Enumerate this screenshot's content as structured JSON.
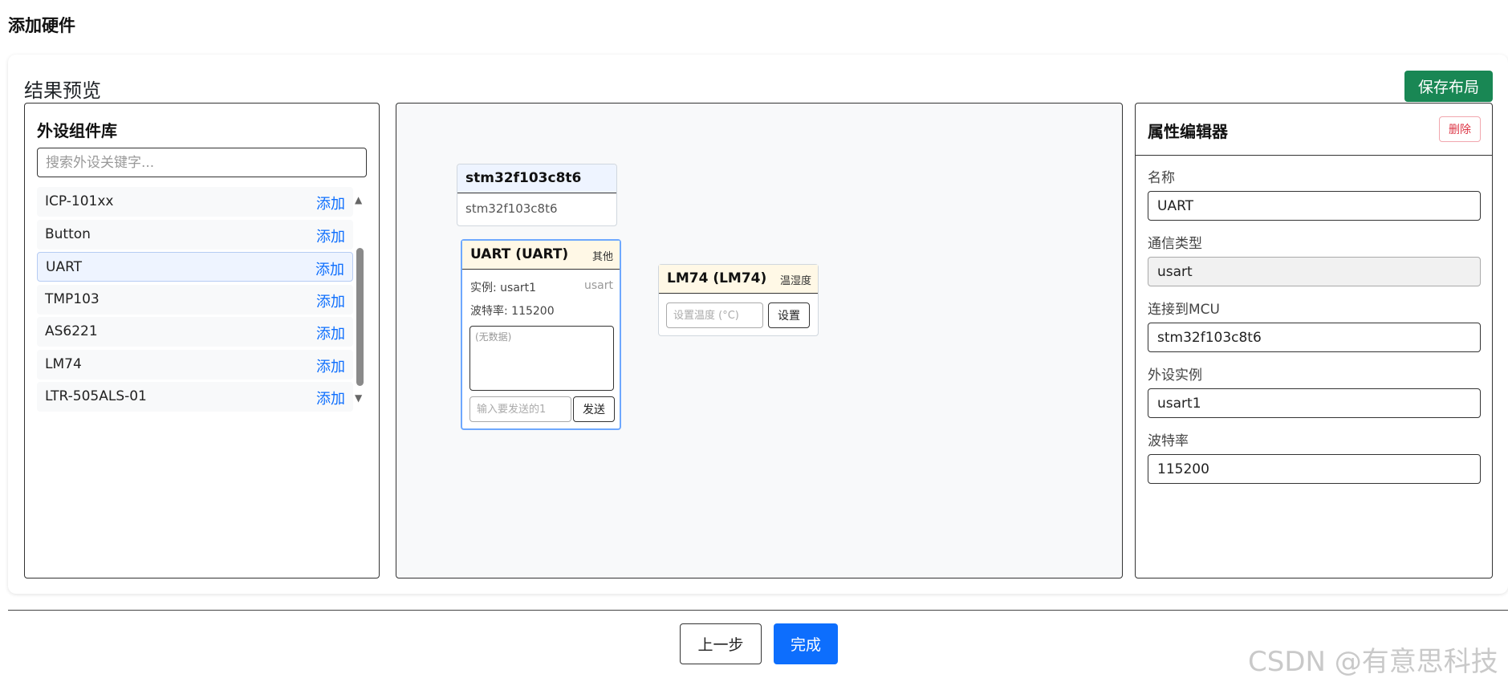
{
  "page": {
    "title": "添加硬件"
  },
  "preview": {
    "title": "结果预览",
    "save_label": "保存布局"
  },
  "library": {
    "title": "外设组件库",
    "search_placeholder": "搜索外设关键字...",
    "add_label": "添加",
    "items": [
      {
        "name": "ICP-101xx"
      },
      {
        "name": "Button"
      },
      {
        "name": "UART",
        "selected": true
      },
      {
        "name": "TMP103"
      },
      {
        "name": "AS6221"
      },
      {
        "name": "LM74"
      },
      {
        "name": "LTR-505ALS-01"
      }
    ]
  },
  "canvas": {
    "mcu": {
      "title": "stm32f103c8t6",
      "subtitle": "stm32f103c8t6"
    },
    "uart": {
      "title": "UART (UART)",
      "tag": "其他",
      "instance": "实例: usart1",
      "instance_type": "usart",
      "baud": "波特率: 115200",
      "output_placeholder": "(无数据)",
      "send_placeholder": "输入要发送的1",
      "send_label": "发送"
    },
    "lm74": {
      "title": "LM74 (LM74)",
      "tag": "温湿度",
      "input_placeholder": "设置温度 (°C)",
      "set_label": "设置"
    }
  },
  "props": {
    "title": "属性编辑器",
    "delete_label": "删除",
    "fields": [
      {
        "label": "名称",
        "value": "UART",
        "readonly": false
      },
      {
        "label": "通信类型",
        "value": "usart",
        "readonly": true
      },
      {
        "label": "连接到MCU",
        "value": "stm32f103c8t6",
        "readonly": false
      },
      {
        "label": "外设实例",
        "value": "usart1",
        "readonly": false
      },
      {
        "label": "波特率",
        "value": "115200",
        "readonly": false
      }
    ]
  },
  "footer": {
    "prev_label": "上一步",
    "finish_label": "完成"
  },
  "watermark": "CSDN @有意思科技",
  "colors": {
    "primary": "#0d6efd",
    "success": "#198754",
    "danger": "#dc3545",
    "selected_bg": "#eef4ff"
  }
}
